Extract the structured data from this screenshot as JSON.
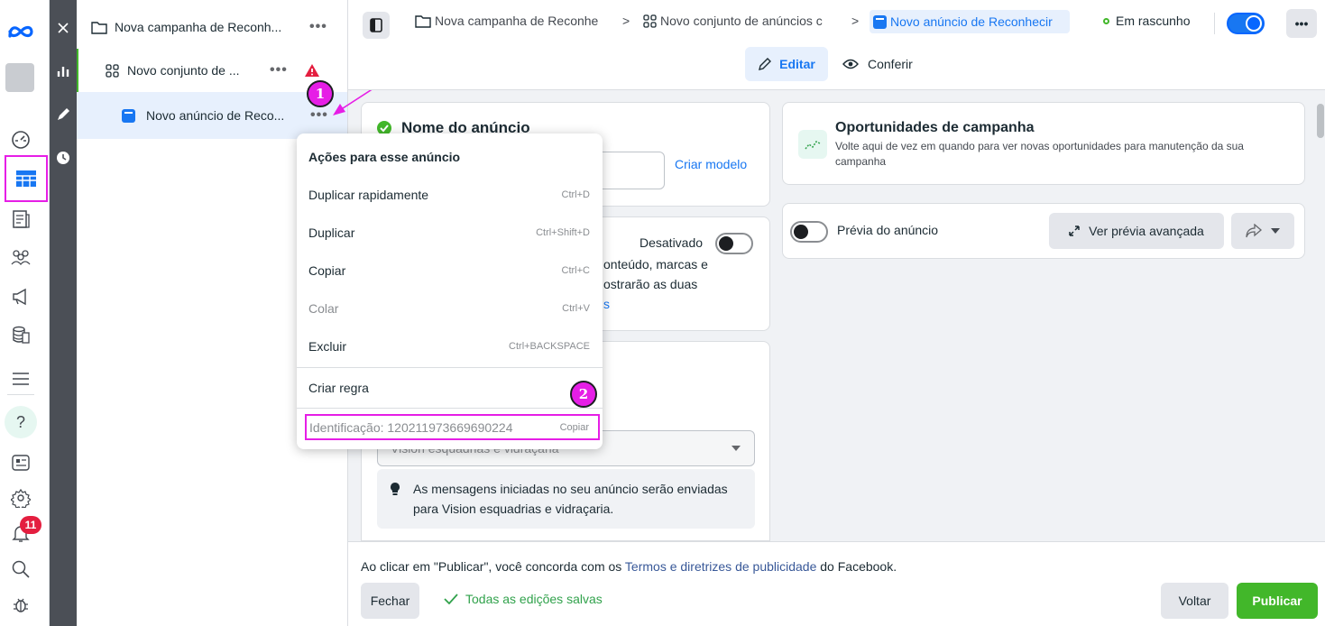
{
  "tree": {
    "campaign": "Nova campanha de Reconh...",
    "adset": "Novo conjunto de ...",
    "ad": "Novo anúncio de Reco...",
    "more": "•••"
  },
  "header": {
    "crumb_campaign": "Nova campanha de Reconhe",
    "crumb_adset": "Novo conjunto de anúncios c",
    "crumb_ad": "Novo anúncio de Reconhecir",
    "status": "Em rascunho",
    "more": "•••",
    "edit_label": "Editar",
    "review_label": "Conferir"
  },
  "ad_name": {
    "title": "Nome do anúncio",
    "template_link": "Criar modelo"
  },
  "partnership": {
    "toggle_label": "Desativado",
    "line1": "onteúdo, marcas e",
    "line2": "ostrarão as duas",
    "link_fragment": "s"
  },
  "messaging": {
    "dropdown_value": "Vision esquadrias e vidraçaria",
    "info_text": "As mensagens iniciadas no seu anúncio serão enviadas para Vision esquadrias e vidraçaria."
  },
  "opportunities": {
    "title": "Oportunidades de campanha",
    "description": "Volte aqui de vez em quando para ver novas oportunidades para manutenção da sua campanha"
  },
  "preview": {
    "label": "Prévia do anúncio",
    "advanced_button": "Ver prévia avançada"
  },
  "menu": {
    "header": "Ações para esse anúncio",
    "items": [
      {
        "label": "Duplicar rapidamente",
        "shortcut": "Ctrl+D"
      },
      {
        "label": "Duplicar",
        "shortcut": "Ctrl+Shift+D"
      },
      {
        "label": "Copiar",
        "shortcut": "Ctrl+C"
      },
      {
        "label": "Colar",
        "shortcut": "Ctrl+V"
      },
      {
        "label": "Excluir",
        "shortcut": "Ctrl+BACKSPACE"
      }
    ],
    "create_rule": "Criar regra",
    "identification": "Identificação: 120211973669690224",
    "copy_label": "Copiar"
  },
  "footer": {
    "terms_prefix": "Ao clicar em \"Publicar\", você concorda com os ",
    "terms_link": "Termos e diretrizes de publicidade",
    "terms_suffix": " do Facebook.",
    "close_label": "Fechar",
    "saved_label": "Todas as edições salvas",
    "back_label": "Voltar",
    "publish_label": "Publicar"
  },
  "rail": {
    "notifications_count": "11"
  },
  "annotations": {
    "step1": "1",
    "step2": "2"
  },
  "colors": {
    "accent_blue": "#1877f2",
    "publish_green": "#42b72a",
    "annotation_magenta": "#e61ee6",
    "selected_bg": "#e7f0fd"
  }
}
